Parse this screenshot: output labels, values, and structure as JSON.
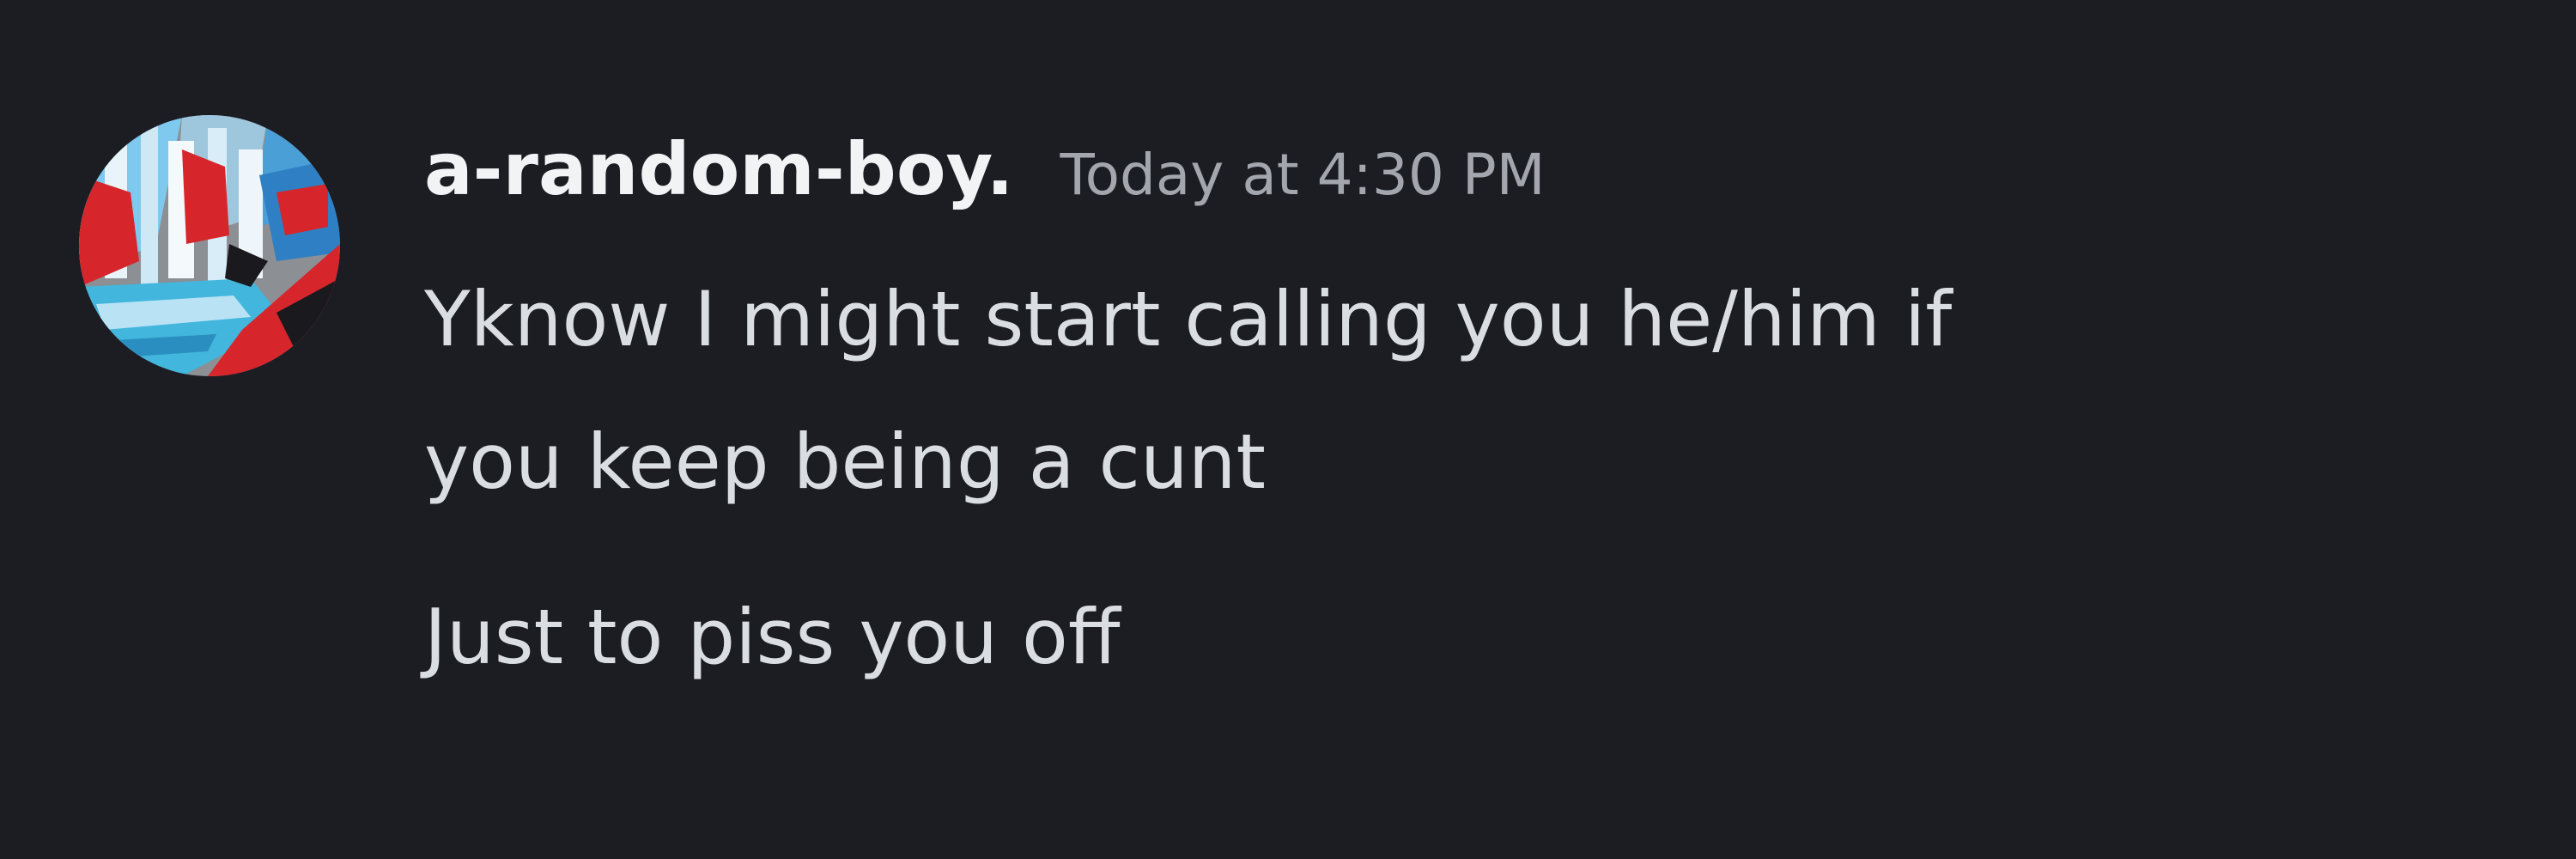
{
  "message": {
    "author": "a-random-boy.",
    "timestamp": "Today at 4:30 PM",
    "lines": [
      "Yknow I might start calling you he/him if",
      "you keep being a cunt",
      "Just to piss you off"
    ]
  },
  "avatar": {
    "icon": "user-avatar-comic-art",
    "colors": {
      "red": "#d6262b",
      "blue": "#2f7fc4",
      "light_blue": "#7fc8ee",
      "cyan": "#42b6dd",
      "gray": "#8c8f93",
      "dark": "#1a1a1e"
    }
  },
  "theme": {
    "background": "#1c1d23",
    "username_color": "#f2f3f5",
    "timestamp_color": "#a3a6ad",
    "text_color": "#dbdee1"
  }
}
